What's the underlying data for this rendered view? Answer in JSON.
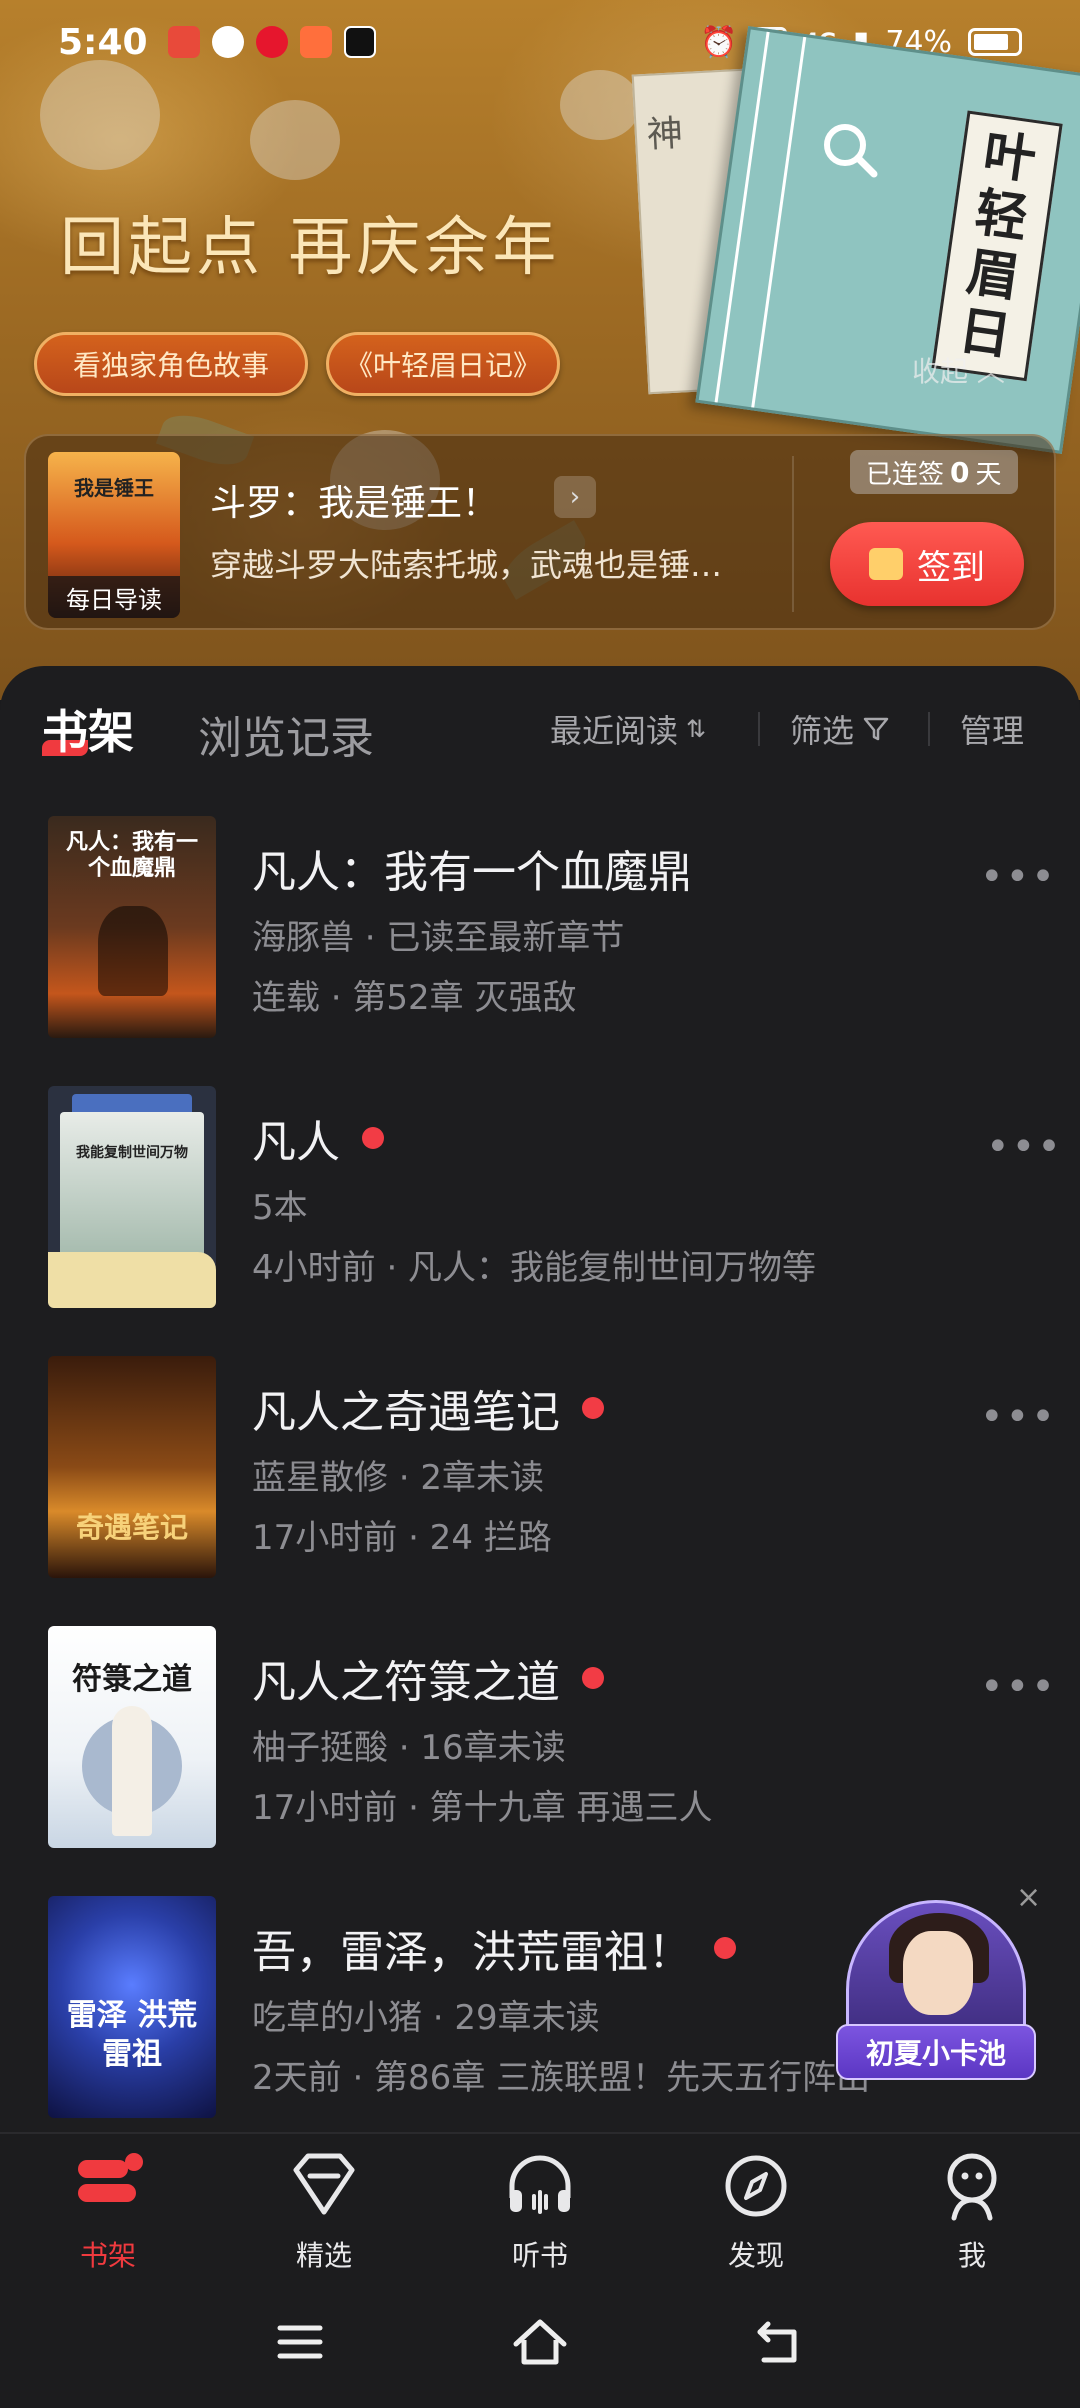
{
  "status_bar": {
    "time": "5:40",
    "network": "4G",
    "hd": "HD",
    "battery": "74%"
  },
  "banner": {
    "slogan": "回起点 再庆余年",
    "pills": [
      "看独家角色故事",
      "《叶轻眉日记》"
    ],
    "book_back_text": "神",
    "book_title_chars": [
      "叶",
      "轻",
      "眉",
      "日"
    ],
    "collapse": "收起"
  },
  "daily_guide": {
    "cover_text": "我是锤王",
    "badge": "每日导读",
    "title": "斗罗：我是锤王！",
    "description": "穿越斗罗大陆索托城，武魂也是锤…",
    "streak_prefix": "已连签",
    "streak_count": "0",
    "streak_suffix": "天",
    "signin_label": "签到"
  },
  "shelf": {
    "tab_active": "书架",
    "tab_inactive": "浏览记录",
    "sort_label": "最近阅读",
    "filter_label": "筛选",
    "manage_label": "管理",
    "books": [
      {
        "cover_text": "凡人：我有一个血魔鼎",
        "title": "凡人：我有一个血魔鼎",
        "line1": "海豚兽 · 已读至最新章节",
        "line2": "连载 · 第52章 灭强敌",
        "unread_dot": false
      },
      {
        "cover_text": "我能复制世间万物",
        "title": "凡人",
        "line1": "5本",
        "line2": "4小时前 · 凡人：我能复制世间万物等",
        "unread_dot": true
      },
      {
        "cover_text": "奇遇笔记",
        "title": "凡人之奇遇笔记",
        "line1": "蓝星散修 · 2章未读",
        "line2": "17小时前 · 24 拦路",
        "unread_dot": true
      },
      {
        "cover_text": "符箓之道",
        "title": "凡人之符箓之道",
        "line1": "柚子挺酸 · 16章未读",
        "line2": "17小时前 · 第十九章 再遇三人",
        "unread_dot": true
      },
      {
        "cover_text": "雷泽 洪荒雷祖",
        "title": "吾，雷泽，洪荒雷祖！",
        "line1": "吃草的小猪 · 29章未读",
        "line2": "2天前 · 第86章 三族联盟！先天五行阵出",
        "unread_dot": true
      }
    ],
    "more_icon": "•••"
  },
  "card_pool": {
    "label": "初夏小卡池",
    "close": "×"
  },
  "bottom_nav": {
    "items": [
      {
        "label": "书架",
        "icon": "bookshelf-icon",
        "active": true
      },
      {
        "label": "精选",
        "icon": "diamond-icon",
        "active": false
      },
      {
        "label": "听书",
        "icon": "headphones-icon",
        "active": false
      },
      {
        "label": "发现",
        "icon": "compass-icon",
        "active": false
      },
      {
        "label": "我",
        "icon": "profile-icon",
        "active": false
      }
    ]
  },
  "colors": {
    "accent": "#f03a3f",
    "background": "#1d1d1f",
    "banner": "#9d6a23"
  }
}
